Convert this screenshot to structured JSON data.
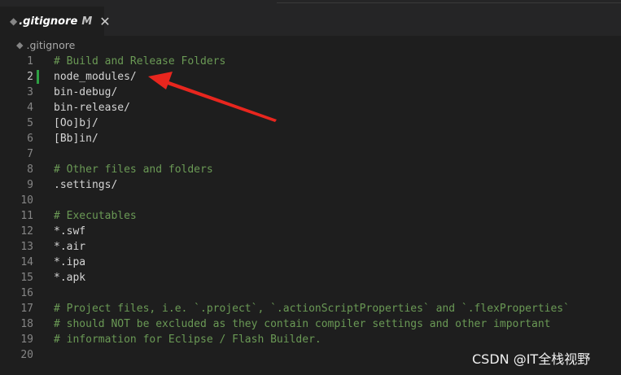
{
  "tab": {
    "icon": "diamond-file-icon",
    "filename": ".gitignore",
    "modified_marker": "M",
    "close_glyph": "✕"
  },
  "breadcrumb": {
    "icon": "diamond-file-icon",
    "label": ".gitignore"
  },
  "editor": {
    "active_line": 2,
    "modified_line_color": "#2ea043",
    "lines": [
      {
        "n": "1",
        "text": "# Build and Release Folders",
        "kind": "comment"
      },
      {
        "n": "2",
        "text": "node_modules/",
        "kind": "plain"
      },
      {
        "n": "3",
        "text": "bin-debug/",
        "kind": "plain"
      },
      {
        "n": "4",
        "text": "bin-release/",
        "kind": "plain"
      },
      {
        "n": "5",
        "text": "[Oo]bj/",
        "kind": "plain"
      },
      {
        "n": "6",
        "text": "[Bb]in/",
        "kind": "plain"
      },
      {
        "n": "7",
        "text": "",
        "kind": "plain"
      },
      {
        "n": "8",
        "text": "# Other files and folders",
        "kind": "comment"
      },
      {
        "n": "9",
        "text": ".settings/",
        "kind": "plain"
      },
      {
        "n": "10",
        "text": "",
        "kind": "plain"
      },
      {
        "n": "11",
        "text": "# Executables",
        "kind": "comment"
      },
      {
        "n": "12",
        "text": "*.swf",
        "kind": "plain"
      },
      {
        "n": "13",
        "text": "*.air",
        "kind": "plain"
      },
      {
        "n": "14",
        "text": "*.ipa",
        "kind": "plain"
      },
      {
        "n": "15",
        "text": "*.apk",
        "kind": "plain"
      },
      {
        "n": "16",
        "text": "",
        "kind": "plain"
      },
      {
        "n": "17",
        "text": "# Project files, i.e. `.project`, `.actionScriptProperties` and `.flexProperties`",
        "kind": "comment"
      },
      {
        "n": "18",
        "text": "# should NOT be excluded as they contain compiler settings and other important",
        "kind": "comment"
      },
      {
        "n": "19",
        "text": "# information for Eclipse / Flash Builder.",
        "kind": "comment"
      },
      {
        "n": "20",
        "text": "",
        "kind": "plain"
      }
    ]
  },
  "annotation": {
    "type": "red-arrow",
    "color": "#e8261e"
  },
  "watermark": "CSDN @IT全栈视野"
}
